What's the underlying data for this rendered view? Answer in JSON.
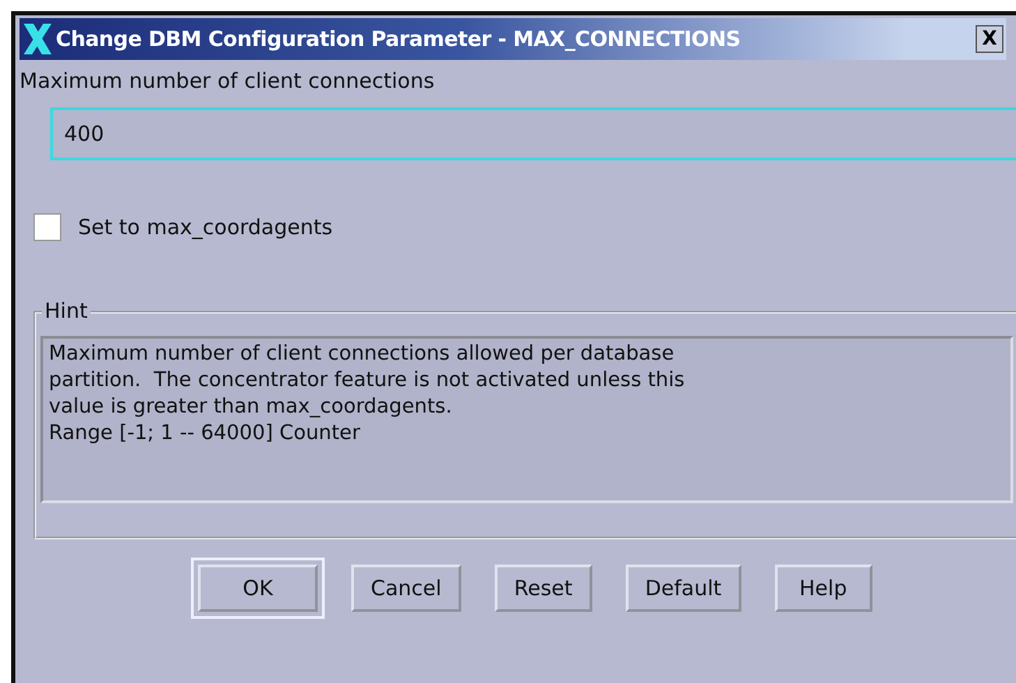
{
  "window": {
    "title": "Change DBM Configuration Parameter - MAX_CONNECTIONS",
    "close": "X"
  },
  "field": {
    "label": "Maximum number of client connections",
    "value": "400"
  },
  "checkbox": {
    "label": "Set to max_coordagents",
    "checked": false
  },
  "hint": {
    "title": "Hint",
    "text": "Maximum number of client connections allowed per database\npartition.  The concentrator feature is not activated unless this\nvalue is greater than max_coordagents.\nRange [-1; 1 -- 64000] Counter"
  },
  "buttons": [
    {
      "label": "OK",
      "default": true
    },
    {
      "label": "Cancel",
      "default": false
    },
    {
      "label": "Reset",
      "default": false
    },
    {
      "label": "Default",
      "default": false
    },
    {
      "label": "Help",
      "default": false
    }
  ]
}
